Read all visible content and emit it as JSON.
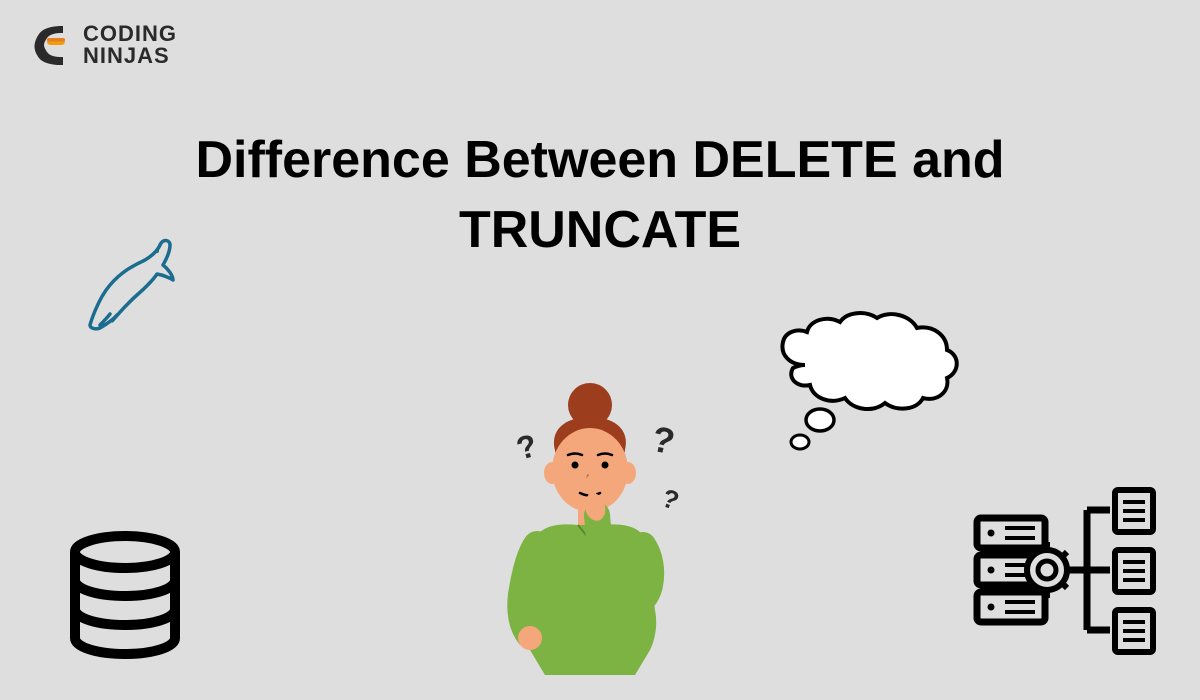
{
  "logo": {
    "line1": "CODING",
    "line2": "NINJAS"
  },
  "title": "Difference Between DELETE and TRUNCATE",
  "icons": {
    "logo": "coding-ninjas-logo",
    "mysql": "mysql-dolphin-icon",
    "database": "database-cylinder-icon",
    "person": "thinking-person-illustration",
    "thought": "thought-bubble-icon",
    "server": "server-diagram-icon"
  }
}
